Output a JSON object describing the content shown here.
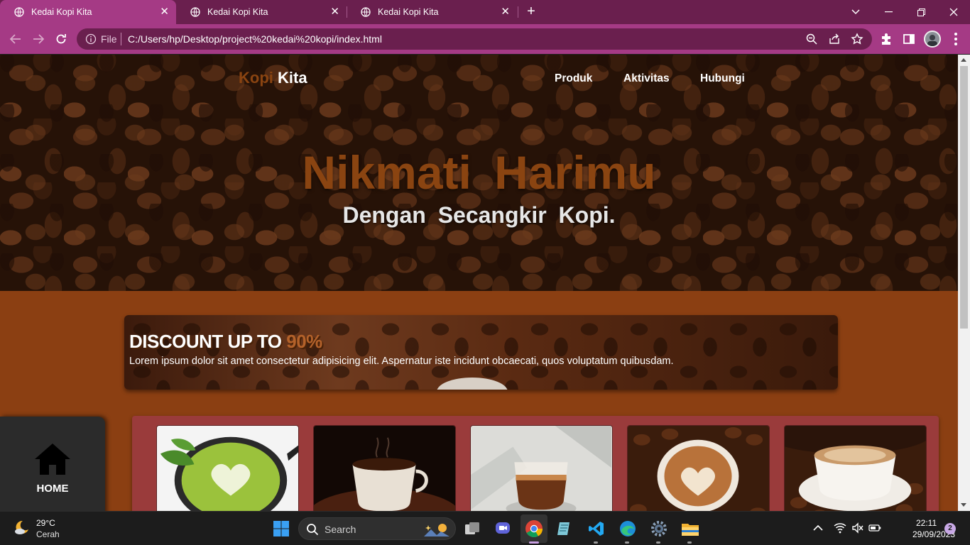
{
  "browser": {
    "tabs": [
      {
        "title": "Kedai Kopi Kita",
        "active": true
      },
      {
        "title": "Kedai Kopi Kita",
        "active": false
      },
      {
        "title": "Kedai Kopi Kita",
        "active": false
      }
    ],
    "omnibox": {
      "scheme_label": "File",
      "url": "C:/Users/hp/Desktop/project%20kedai%20kopi/index.html"
    },
    "colors": {
      "tabbar": "#6a1f4e",
      "toolbar": "#a53a85"
    }
  },
  "page": {
    "logo": {
      "part1": "Kopi",
      "part2": "Kita"
    },
    "nav": [
      "Produk",
      "Aktivitas",
      "Hubungi"
    ],
    "hero": {
      "title": "Nikmati  Harimu",
      "subtitle": "Dengan  Secangkir  Kopi."
    },
    "discount": {
      "title_prefix": "DISCOUNT UP TO",
      "title_percent": "90%",
      "text": "Lorem ipsum dolor sit amet consectetur adipisicing elit. Aspernatur iste incidunt obcaecati, quos voluptatum quibusdam."
    },
    "products": [
      {
        "image": "matcha-latte-art"
      },
      {
        "image": "coffee-cup-beans-dark"
      },
      {
        "image": "espresso-glass"
      },
      {
        "image": "latte-art-beans"
      },
      {
        "image": "cappuccino-beans"
      }
    ],
    "home_button": {
      "label": "HOME",
      "icon": "home-icon"
    },
    "colors": {
      "accent": "#8a4411",
      "background": "#8b3f12",
      "products_panel": "#9a3b3b"
    }
  },
  "taskbar": {
    "weather": {
      "temp": "29°C",
      "condition": "Cerah"
    },
    "search_placeholder": "Search",
    "apps": [
      "start-icon",
      "task-view-icon",
      "chat-icon",
      "chrome-icon",
      "notepad-icon",
      "vscode-icon",
      "edge-icon",
      "settings-icon",
      "file-explorer-icon"
    ],
    "clock": {
      "time": "22:11",
      "date": "29/09/2023"
    },
    "notification_count": "2"
  }
}
